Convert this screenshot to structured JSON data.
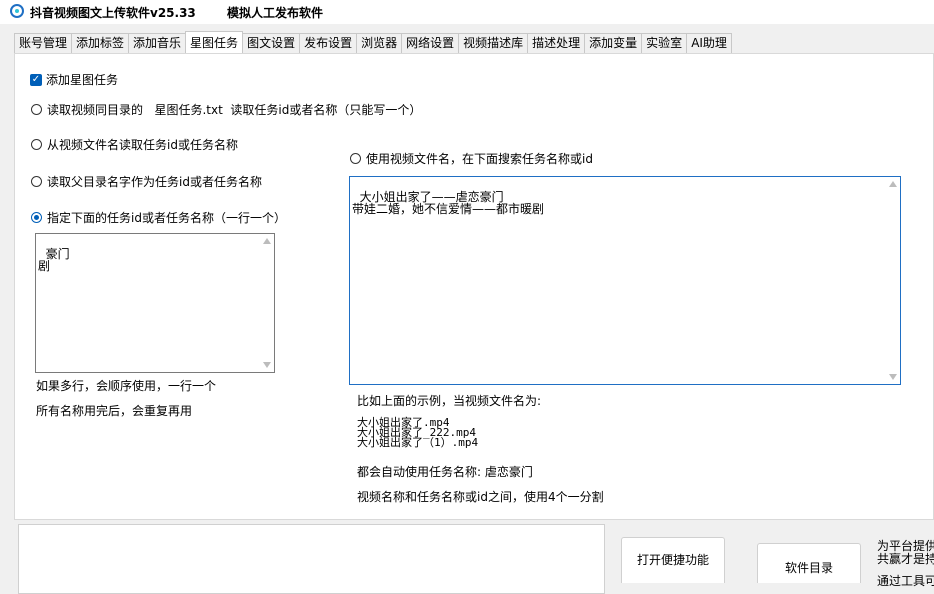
{
  "window": {
    "title": "抖音视频图文上传软件v25.33",
    "subtitle": "模拟人工发布软件"
  },
  "tabs": [
    {
      "label": "账号管理"
    },
    {
      "label": "添加标签"
    },
    {
      "label": "添加音乐"
    },
    {
      "label": "星图任务",
      "active": true
    },
    {
      "label": "图文设置"
    },
    {
      "label": "发布设置"
    },
    {
      "label": "浏览器"
    },
    {
      "label": "网络设置"
    },
    {
      "label": "视频描述库"
    },
    {
      "label": "描述处理"
    },
    {
      "label": "添加变量"
    },
    {
      "label": "实验室"
    },
    {
      "label": "AI助理"
    }
  ],
  "star_task": {
    "add_checkbox": {
      "label": "添加星图任务",
      "checked": true
    },
    "options": {
      "same_dir": {
        "label": "读取视频同目录的   星图任务.txt  读取任务id或者名称（只能写一个）",
        "selected": false
      },
      "from_filename": {
        "label": "从视频文件名读取任务id或任务名称",
        "selected": false
      },
      "parent_dir": {
        "label": "读取父目录名字作为任务id或者任务名称",
        "selected": false
      },
      "specified": {
        "label": "指定下面的任务id或者任务名称（一行一个）",
        "selected": true
      },
      "search_filename": {
        "label": "使用视频文件名，在下面搜索任务名称或id",
        "selected": false
      }
    },
    "specified_text": "豪门\n剧",
    "multi_line_note": "如果多行，会顺序使用，一行一个",
    "reuse_note": "所有名称用完后，会重复再用",
    "search_text": "大小姐出家了——虐恋豪门\n带娃二婚，她不信爱情——都市暖剧",
    "example_intro": "比如上面的示例，当视频文件名为:",
    "example_files": "大小姐出家了.mp4\n大小姐出家了_222.mp4\n大小姐出家了（1）.mp4",
    "auto_use_note": "都会自动使用任务名称: 虐恋豪门",
    "separator_note": "视频名称和任务名称或id之间，使用4个一分割"
  },
  "bottom": {
    "shortcut_button": "打开便捷功能",
    "software_dir_button": "软件目录",
    "right_text_1": "为平台提供",
    "right_text_2": "共赢才是持",
    "right_text_3": "通过工具可"
  },
  "colors": {
    "accent": "#005fb8",
    "textbox_focus": "#1f6fc4"
  }
}
